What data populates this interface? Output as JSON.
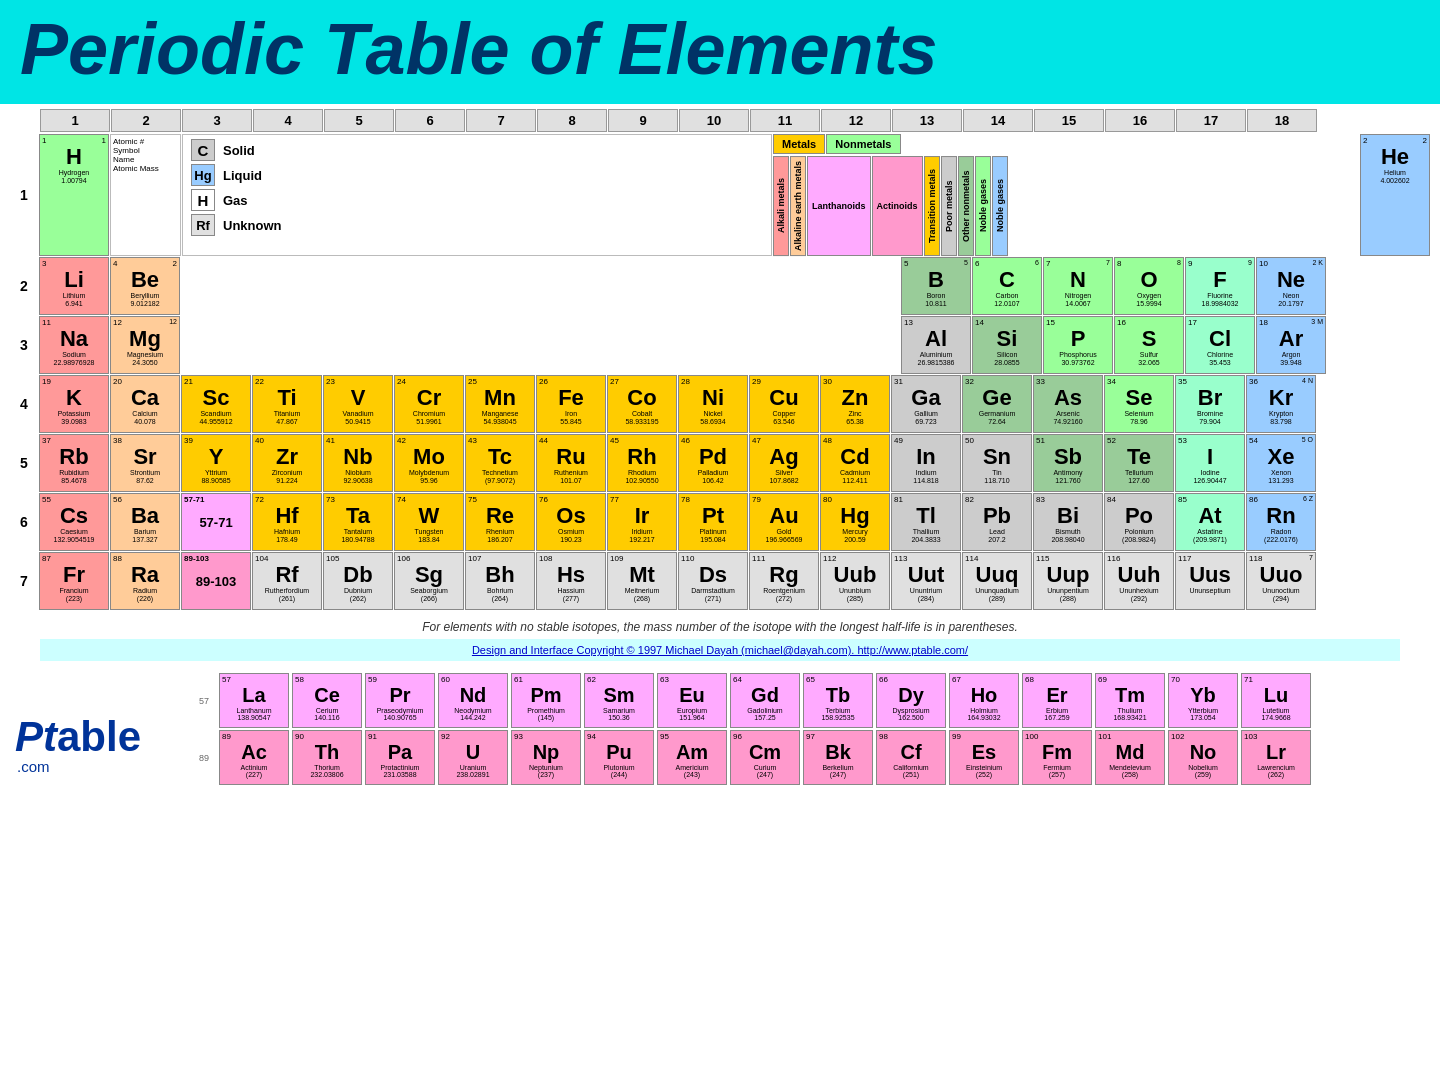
{
  "header": {
    "title": "Periodic Table of Elements"
  },
  "groups": [
    1,
    2,
    3,
    4,
    5,
    6,
    7,
    8,
    9,
    10,
    11,
    12,
    13,
    14,
    15,
    16,
    17,
    18
  ],
  "periods": [
    1,
    2,
    3,
    4,
    5,
    6,
    7
  ],
  "legend": {
    "state_solid": "Solid",
    "state_liquid": "Liquid",
    "state_gas": "Gas",
    "state_unknown": "Unknown",
    "solid_symbol": "C",
    "liquid_symbol": "Hg",
    "gas_symbol": "H",
    "unknown_symbol": "Rf",
    "metals_label": "Metals",
    "nonmetals_label": "Nonmetals",
    "categories": [
      {
        "label": "Alkali metals",
        "color": "cat-alkali",
        "vertical": true
      },
      {
        "label": "Alkaline earth metals",
        "color": "cat-alkaline",
        "vertical": true
      },
      {
        "label": "Lanthanoids",
        "color": "cat-lanthanide",
        "vertical": false
      },
      {
        "label": "Actinoids",
        "color": "cat-actinide",
        "vertical": false
      },
      {
        "label": "Transition metals",
        "color": "cat-transition",
        "vertical": true
      },
      {
        "label": "Poor metals",
        "color": "cat-poor",
        "vertical": true
      },
      {
        "label": "Other nonmetals",
        "color": "cat-other-nonmetal",
        "vertical": true
      },
      {
        "label": "Noble gases",
        "color": "cat-noble",
        "vertical": true
      }
    ],
    "atomic_info": {
      "line1": "Atomic #",
      "line2": "Symbol",
      "line3": "Name",
      "line4": "Atomic Mass"
    }
  },
  "footnote": "For elements with no stable isotopes, the mass number of the isotope with the longest half-life is in parentheses.",
  "copyright": "Design and Interface Copyright © 1997 Michael Dayah (michael@dayah.com). http://www.ptable.com/",
  "elements": {
    "H": {
      "number": 1,
      "symbol": "H",
      "name": "Hydrogen",
      "mass": "1.00794",
      "category": "hydrogen-elem"
    },
    "He": {
      "number": 2,
      "symbol": "He",
      "name": "Helium",
      "mass": "4.002602",
      "category": "noble-gas"
    },
    "Li": {
      "number": 3,
      "symbol": "Li",
      "name": "Lithium",
      "mass": "6.941",
      "category": "alkali"
    },
    "Be": {
      "number": 4,
      "symbol": "Be",
      "name": "Beryllium",
      "mass": "9.012182",
      "category": "alkaline-earth"
    },
    "B": {
      "number": 5,
      "symbol": "B",
      "name": "Boron",
      "mass": "10.811",
      "category": "metalloid"
    },
    "C": {
      "number": 6,
      "symbol": "C",
      "name": "Carbon",
      "mass": "12.0107",
      "category": "nonmetal"
    },
    "N": {
      "number": 7,
      "symbol": "N",
      "name": "Nitrogen",
      "mass": "14.0067",
      "category": "nonmetal"
    },
    "O": {
      "number": 8,
      "symbol": "O",
      "name": "Oxygen",
      "mass": "15.9994",
      "category": "nonmetal"
    },
    "F": {
      "number": 9,
      "symbol": "F",
      "name": "Fluorine",
      "mass": "18.9984032",
      "category": "halogen"
    },
    "Ne": {
      "number": 10,
      "symbol": "Ne",
      "name": "Neon",
      "mass": "20.1797",
      "category": "noble-gas"
    },
    "Na": {
      "number": 11,
      "symbol": "Na",
      "name": "Sodium",
      "mass": "22.98976928",
      "category": "alkali"
    },
    "Mg": {
      "number": 12,
      "symbol": "Mg",
      "name": "Magnesium",
      "mass": "24.3050",
      "category": "alkaline-earth"
    },
    "Al": {
      "number": 13,
      "symbol": "Al",
      "name": "Aluminium",
      "mass": "26.9815386",
      "category": "post-transition"
    },
    "Si": {
      "number": 14,
      "symbol": "Si",
      "name": "Silicon",
      "mass": "28.0855",
      "category": "metalloid"
    },
    "P": {
      "number": 15,
      "symbol": "P",
      "name": "Phosphorus",
      "mass": "30.973762",
      "category": "nonmetal"
    },
    "S": {
      "number": 16,
      "symbol": "S",
      "name": "Sulfur",
      "mass": "32.065",
      "category": "nonmetal"
    },
    "Cl": {
      "number": 17,
      "symbol": "Cl",
      "name": "Chlorine",
      "mass": "35.453",
      "category": "halogen"
    },
    "Ar": {
      "number": 18,
      "symbol": "Ar",
      "name": "Argon",
      "mass": "39.948",
      "category": "noble-gas"
    },
    "K": {
      "number": 19,
      "symbol": "K",
      "name": "Potassium",
      "mass": "39.0983",
      "category": "alkali"
    },
    "Ca": {
      "number": 20,
      "symbol": "Ca",
      "name": "Calcium",
      "mass": "40.078",
      "category": "alkaline-earth"
    },
    "Sc": {
      "number": 21,
      "symbol": "Sc",
      "name": "Scandium",
      "mass": "44.955912",
      "category": "transition"
    },
    "Ti": {
      "number": 22,
      "symbol": "Ti",
      "name": "Titanium",
      "mass": "47.867",
      "category": "transition"
    },
    "V": {
      "number": 23,
      "symbol": "V",
      "name": "Vanadium",
      "mass": "50.9415",
      "category": "transition"
    },
    "Cr": {
      "number": 24,
      "symbol": "Cr",
      "name": "Chromium",
      "mass": "51.9961",
      "category": "transition"
    },
    "Mn": {
      "number": 25,
      "symbol": "Mn",
      "name": "Manganese",
      "mass": "54.938045",
      "category": "transition"
    },
    "Fe": {
      "number": 26,
      "symbol": "Fe",
      "name": "Iron",
      "mass": "55.845",
      "category": "transition"
    },
    "Co": {
      "number": 27,
      "symbol": "Co",
      "name": "Cobalt",
      "mass": "58.933195",
      "category": "transition"
    },
    "Ni": {
      "number": 28,
      "symbol": "Ni",
      "name": "Nickel",
      "mass": "58.6934",
      "category": "transition"
    },
    "Cu": {
      "number": 29,
      "symbol": "Cu",
      "name": "Copper",
      "mass": "63.546",
      "category": "transition"
    },
    "Zn": {
      "number": 30,
      "symbol": "Zn",
      "name": "Zinc",
      "mass": "65.38",
      "category": "transition"
    },
    "Ga": {
      "number": 31,
      "symbol": "Ga",
      "name": "Gallium",
      "mass": "69.723",
      "category": "post-transition"
    },
    "Ge": {
      "number": 32,
      "symbol": "Ge",
      "name": "Germanium",
      "mass": "72.64",
      "category": "metalloid"
    },
    "As": {
      "number": 33,
      "symbol": "As",
      "name": "Arsenic",
      "mass": "74.92160",
      "category": "metalloid"
    },
    "Se": {
      "number": 34,
      "symbol": "Se",
      "name": "Selenium",
      "mass": "78.96",
      "category": "nonmetal"
    },
    "Br": {
      "number": 35,
      "symbol": "Br",
      "name": "Bromine",
      "mass": "79.904",
      "category": "halogen"
    },
    "Kr": {
      "number": 36,
      "symbol": "Kr",
      "name": "Krypton",
      "mass": "83.798",
      "category": "noble-gas"
    },
    "Rb": {
      "number": 37,
      "symbol": "Rb",
      "name": "Rubidium",
      "mass": "85.4678",
      "category": "alkali"
    },
    "Sr": {
      "number": 38,
      "symbol": "Sr",
      "name": "Strontium",
      "mass": "87.62",
      "category": "alkaline-earth"
    },
    "Y": {
      "number": 39,
      "symbol": "Y",
      "name": "Yttrium",
      "mass": "88.90585",
      "category": "transition"
    },
    "Zr": {
      "number": 40,
      "symbol": "Zr",
      "name": "Zirconium",
      "mass": "91.224",
      "category": "transition"
    },
    "Nb": {
      "number": 41,
      "symbol": "Nb",
      "name": "Niobium",
      "mass": "92.90638",
      "category": "transition"
    },
    "Mo": {
      "number": 42,
      "symbol": "Mo",
      "name": "Molybdenum",
      "mass": "95.96",
      "category": "transition"
    },
    "Tc": {
      "number": 43,
      "symbol": "Tc",
      "name": "Technetium",
      "mass": "(97.9072)",
      "category": "transition"
    },
    "Ru": {
      "number": 44,
      "symbol": "Ru",
      "name": "Ruthenium",
      "mass": "101.07",
      "category": "transition"
    },
    "Rh": {
      "number": 45,
      "symbol": "Rh",
      "name": "Rhodium",
      "mass": "102.90550",
      "category": "transition"
    },
    "Pd": {
      "number": 46,
      "symbol": "Pd",
      "name": "Palladium",
      "mass": "106.42",
      "category": "transition"
    },
    "Ag": {
      "number": 47,
      "symbol": "Ag",
      "name": "Silver",
      "mass": "107.8682",
      "category": "transition"
    },
    "Cd": {
      "number": 48,
      "symbol": "Cd",
      "name": "Cadmium",
      "mass": "112.411",
      "category": "transition"
    },
    "In": {
      "number": 49,
      "symbol": "In",
      "name": "Indium",
      "mass": "114.818",
      "category": "post-transition"
    },
    "Sn": {
      "number": 50,
      "symbol": "Sn",
      "name": "Tin",
      "mass": "118.710",
      "category": "post-transition"
    },
    "Sb": {
      "number": 51,
      "symbol": "Sb",
      "name": "Antimony",
      "mass": "121.760",
      "category": "metalloid"
    },
    "Te": {
      "number": 52,
      "symbol": "Te",
      "name": "Tellurium",
      "mass": "127.60",
      "category": "metalloid"
    },
    "I": {
      "number": 53,
      "symbol": "I",
      "name": "Iodine",
      "mass": "126.90447",
      "category": "halogen"
    },
    "Xe": {
      "number": 54,
      "symbol": "Xe",
      "name": "Xenon",
      "mass": "131.293",
      "category": "noble-gas"
    },
    "Cs": {
      "number": 55,
      "symbol": "Cs",
      "name": "Caesium",
      "mass": "132.9054519",
      "category": "alkali"
    },
    "Ba": {
      "number": 56,
      "symbol": "Ba",
      "name": "Barium",
      "mass": "137.327",
      "category": "alkaline-earth"
    },
    "La_placeholder": {
      "number": "57-71",
      "symbol": "57-71",
      "name": "",
      "mass": "",
      "category": "lanthanide"
    },
    "Hf": {
      "number": 72,
      "symbol": "Hf",
      "name": "Hafnium",
      "mass": "178.49",
      "category": "transition"
    },
    "Ta": {
      "number": 73,
      "symbol": "Ta",
      "name": "Tantalum",
      "mass": "180.94788",
      "category": "transition"
    },
    "W": {
      "number": 74,
      "symbol": "W",
      "name": "Tungsten",
      "mass": "183.84",
      "category": "transition"
    },
    "Re": {
      "number": 75,
      "symbol": "Re",
      "name": "Rhenium",
      "mass": "186.207",
      "category": "transition"
    },
    "Os": {
      "number": 76,
      "symbol": "Os",
      "name": "Osmium",
      "mass": "190.23",
      "category": "transition"
    },
    "Ir": {
      "number": 77,
      "symbol": "Ir",
      "name": "Iridium",
      "mass": "192.217",
      "category": "transition"
    },
    "Pt": {
      "number": 78,
      "symbol": "Pt",
      "name": "Platinum",
      "mass": "195.084",
      "category": "transition"
    },
    "Au": {
      "number": 79,
      "symbol": "Au",
      "name": "Gold",
      "mass": "196.966569",
      "category": "transition"
    },
    "Hg": {
      "number": 80,
      "symbol": "Hg",
      "name": "Mercury",
      "mass": "200.59",
      "category": "transition"
    },
    "Tl": {
      "number": 81,
      "symbol": "Tl",
      "name": "Thallium",
      "mass": "204.3833",
      "category": "post-transition"
    },
    "Pb": {
      "number": 82,
      "symbol": "Pb",
      "name": "Lead",
      "mass": "207.2",
      "category": "post-transition"
    },
    "Bi": {
      "number": 83,
      "symbol": "Bi",
      "name": "Bismuth",
      "mass": "208.98040",
      "category": "post-transition"
    },
    "Po": {
      "number": 84,
      "symbol": "Po",
      "name": "Polonium",
      "mass": "(208.9824)",
      "category": "post-transition"
    },
    "At": {
      "number": 85,
      "symbol": "At",
      "name": "Astatine",
      "mass": "(209.9871)",
      "category": "halogen"
    },
    "Rn": {
      "number": 86,
      "symbol": "Rn",
      "name": "Radon",
      "mass": "(222.0176)",
      "category": "noble-gas"
    },
    "Fr": {
      "number": 87,
      "symbol": "Fr",
      "name": "Francium",
      "mass": "(223)",
      "category": "alkali"
    },
    "Ra": {
      "number": 88,
      "symbol": "Ra",
      "name": "Radium",
      "mass": "(226)",
      "category": "alkaline-earth"
    },
    "Ac_placeholder": {
      "number": "89-103",
      "symbol": "89-103",
      "name": "",
      "mass": "",
      "category": "actinide"
    },
    "Rf": {
      "number": 104,
      "symbol": "Rf",
      "name": "Rutherfordium",
      "mass": "(261)",
      "category": "unknown-elem"
    },
    "Db": {
      "number": 105,
      "symbol": "Db",
      "name": "Dubnium",
      "mass": "(262)",
      "category": "unknown-elem"
    },
    "Sg": {
      "number": 106,
      "symbol": "Sg",
      "name": "Seaborgium",
      "mass": "(266)",
      "category": "unknown-elem"
    },
    "Bh": {
      "number": 107,
      "symbol": "Bh",
      "name": "Bohrium",
      "mass": "(264)",
      "category": "unknown-elem"
    },
    "Hs": {
      "number": 108,
      "symbol": "Hs",
      "name": "Hassium",
      "mass": "(277)",
      "category": "unknown-elem"
    },
    "Mt": {
      "number": 109,
      "symbol": "Mt",
      "name": "Meitnerium",
      "mass": "(268)",
      "category": "unknown-elem"
    },
    "Ds": {
      "number": 110,
      "symbol": "Ds",
      "name": "Darmstadtium",
      "mass": "(271)",
      "category": "unknown-elem"
    },
    "Rg": {
      "number": 111,
      "symbol": "Rg",
      "name": "Roentgenium",
      "mass": "(272)",
      "category": "unknown-elem"
    },
    "Uub": {
      "number": 112,
      "symbol": "Uub",
      "name": "Ununbium",
      "mass": "(285)",
      "category": "unknown-elem"
    },
    "Uut": {
      "number": 113,
      "symbol": "Uut",
      "name": "Ununtrium",
      "mass": "(284)",
      "category": "unknown-elem"
    },
    "Uuq": {
      "number": 114,
      "symbol": "Uuq",
      "name": "Ununquadium",
      "mass": "(289)",
      "category": "unknown-elem"
    },
    "Uup": {
      "number": 115,
      "symbol": "Uup",
      "name": "Ununpentium",
      "mass": "(288)",
      "category": "unknown-elem"
    },
    "Uuh": {
      "number": 116,
      "symbol": "Uuh",
      "name": "Ununhexium",
      "mass": "(292)",
      "category": "unknown-elem"
    },
    "Uus": {
      "number": 117,
      "symbol": "Uus",
      "name": "Ununseptium",
      "mass": "",
      "category": "unknown-elem"
    },
    "Uuo": {
      "number": 118,
      "symbol": "Uuo",
      "name": "Ununoctium",
      "mass": "(294)",
      "category": "unknown-elem"
    },
    "La": {
      "number": 57,
      "symbol": "La",
      "name": "Lanthanum",
      "mass": "138.90547",
      "category": "lanthanide"
    },
    "Ce": {
      "number": 58,
      "symbol": "Ce",
      "name": "Cerium",
      "mass": "140.116",
      "category": "lanthanide"
    },
    "Pr": {
      "number": 59,
      "symbol": "Pr",
      "name": "Praseodymium",
      "mass": "140.90765",
      "category": "lanthanide"
    },
    "Nd": {
      "number": 60,
      "symbol": "Nd",
      "name": "Neodymium",
      "mass": "144.242",
      "category": "lanthanide"
    },
    "Pm": {
      "number": 61,
      "symbol": "Pm",
      "name": "Promethium",
      "mass": "(145)",
      "category": "lanthanide"
    },
    "Sm": {
      "number": 62,
      "symbol": "Sm",
      "name": "Samarium",
      "mass": "150.36",
      "category": "lanthanide"
    },
    "Eu": {
      "number": 63,
      "symbol": "Eu",
      "name": "Europium",
      "mass": "151.964",
      "category": "lanthanide"
    },
    "Gd": {
      "number": 64,
      "symbol": "Gd",
      "name": "Gadolinium",
      "mass": "157.25",
      "category": "lanthanide"
    },
    "Tb": {
      "number": 65,
      "symbol": "Tb",
      "name": "Terbium",
      "mass": "158.92535",
      "category": "lanthanide"
    },
    "Dy": {
      "number": 66,
      "symbol": "Dy",
      "name": "Dysprosium",
      "mass": "162.500",
      "category": "lanthanide"
    },
    "Ho": {
      "number": 67,
      "symbol": "Ho",
      "name": "Holmium",
      "mass": "164.93032",
      "category": "lanthanide"
    },
    "Er": {
      "number": 68,
      "symbol": "Er",
      "name": "Erbium",
      "mass": "167.259",
      "category": "lanthanide"
    },
    "Tm": {
      "number": 69,
      "symbol": "Tm",
      "name": "Thulium",
      "mass": "168.93421",
      "category": "lanthanide"
    },
    "Yb": {
      "number": 70,
      "symbol": "Yb",
      "name": "Ytterbium",
      "mass": "173.054",
      "category": "lanthanide"
    },
    "Lu": {
      "number": 71,
      "symbol": "Lu",
      "name": "Lutetium",
      "mass": "174.9668",
      "category": "lanthanide"
    },
    "Ac": {
      "number": 89,
      "symbol": "Ac",
      "name": "Actinium",
      "mass": "(227)",
      "category": "actinide"
    },
    "Th": {
      "number": 90,
      "symbol": "Th",
      "name": "Thorium",
      "mass": "232.03806",
      "category": "actinide"
    },
    "Pa": {
      "number": 91,
      "symbol": "Pa",
      "name": "Protactinium",
      "mass": "231.03588",
      "category": "actinide"
    },
    "U": {
      "number": 92,
      "symbol": "U",
      "name": "Uranium",
      "mass": "238.02891",
      "category": "actinide"
    },
    "Np": {
      "number": 93,
      "symbol": "Np",
      "name": "Neptunium",
      "mass": "(237)",
      "category": "actinide"
    },
    "Pu": {
      "number": 94,
      "symbol": "Pu",
      "name": "Plutonium",
      "mass": "(244)",
      "category": "actinide"
    },
    "Am": {
      "number": 95,
      "symbol": "Am",
      "name": "Americium",
      "mass": "(243)",
      "category": "actinide"
    },
    "Cm": {
      "number": 96,
      "symbol": "Cm",
      "name": "Curium",
      "mass": "(247)",
      "category": "actinide"
    },
    "Bk": {
      "number": 97,
      "symbol": "Bk",
      "name": "Berkelium",
      "mass": "(247)",
      "category": "actinide"
    },
    "Cf": {
      "number": 98,
      "symbol": "Cf",
      "name": "Californium",
      "mass": "(251)",
      "category": "actinide"
    },
    "Es": {
      "number": 99,
      "symbol": "Es",
      "name": "Einsteinium",
      "mass": "(252)",
      "category": "actinide"
    },
    "Fm": {
      "number": 100,
      "symbol": "Fm",
      "name": "Fermium",
      "mass": "(257)",
      "category": "actinide"
    },
    "Md": {
      "number": 101,
      "symbol": "Md",
      "name": "Mendelevium",
      "mass": "(258)",
      "category": "actinide"
    },
    "No": {
      "number": 102,
      "symbol": "No",
      "name": "Nobelium",
      "mass": "(259)",
      "category": "actinide"
    },
    "Lr": {
      "number": 103,
      "symbol": "Lr",
      "name": "Lawrencium",
      "mass": "(262)",
      "category": "actinide"
    }
  },
  "logo": {
    "pt": "Pt",
    "able": "able",
    "com": ".com"
  }
}
